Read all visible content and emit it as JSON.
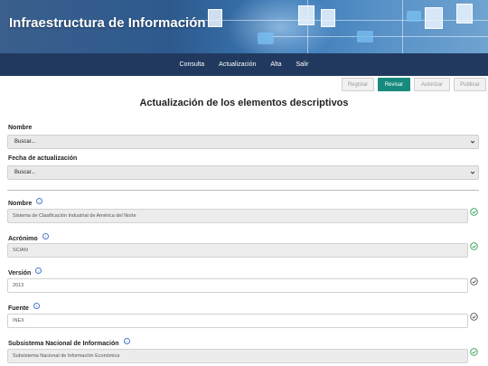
{
  "banner": {
    "title": "Infraestructura de Información"
  },
  "nav": {
    "items": [
      "Consulta",
      "Actualización",
      "Alta",
      "Salir"
    ]
  },
  "actions": {
    "registrar": "Registar",
    "revisar": "Revisar",
    "autorizar": "Autorizar",
    "publicar": "Publicar"
  },
  "page": {
    "title": "Actualización de los elementos descriptivos"
  },
  "filters": {
    "nombre": {
      "label": "Nombre",
      "value": "Buscar..."
    },
    "fecha": {
      "label": "Fecha de actualización",
      "value": "Buscar..."
    }
  },
  "fields": [
    {
      "label": "Nombre",
      "value": "Sistema de Clasificación Industrial de América del Norte",
      "status": "valid",
      "status_color": "#2e9e4f"
    },
    {
      "label": "Acrónimo",
      "value": "SCIAN",
      "status": "valid",
      "status_color": "#2e9e4f"
    },
    {
      "label": "Versión",
      "value": "2013",
      "status": "neutral",
      "status_color": "#555555"
    },
    {
      "label": "Fuente",
      "value": "INEX",
      "status": "neutral",
      "status_color": "#555555"
    },
    {
      "label": "Subsistema Nacional de Información",
      "value": "Subsistema Nacional de Información Económica",
      "status": "valid",
      "status_color": "#2e9e4f"
    }
  ],
  "colors": {
    "nav_bg": "#22395f",
    "primary_button": "#178a7e",
    "info_icon": "#4a78c8"
  }
}
